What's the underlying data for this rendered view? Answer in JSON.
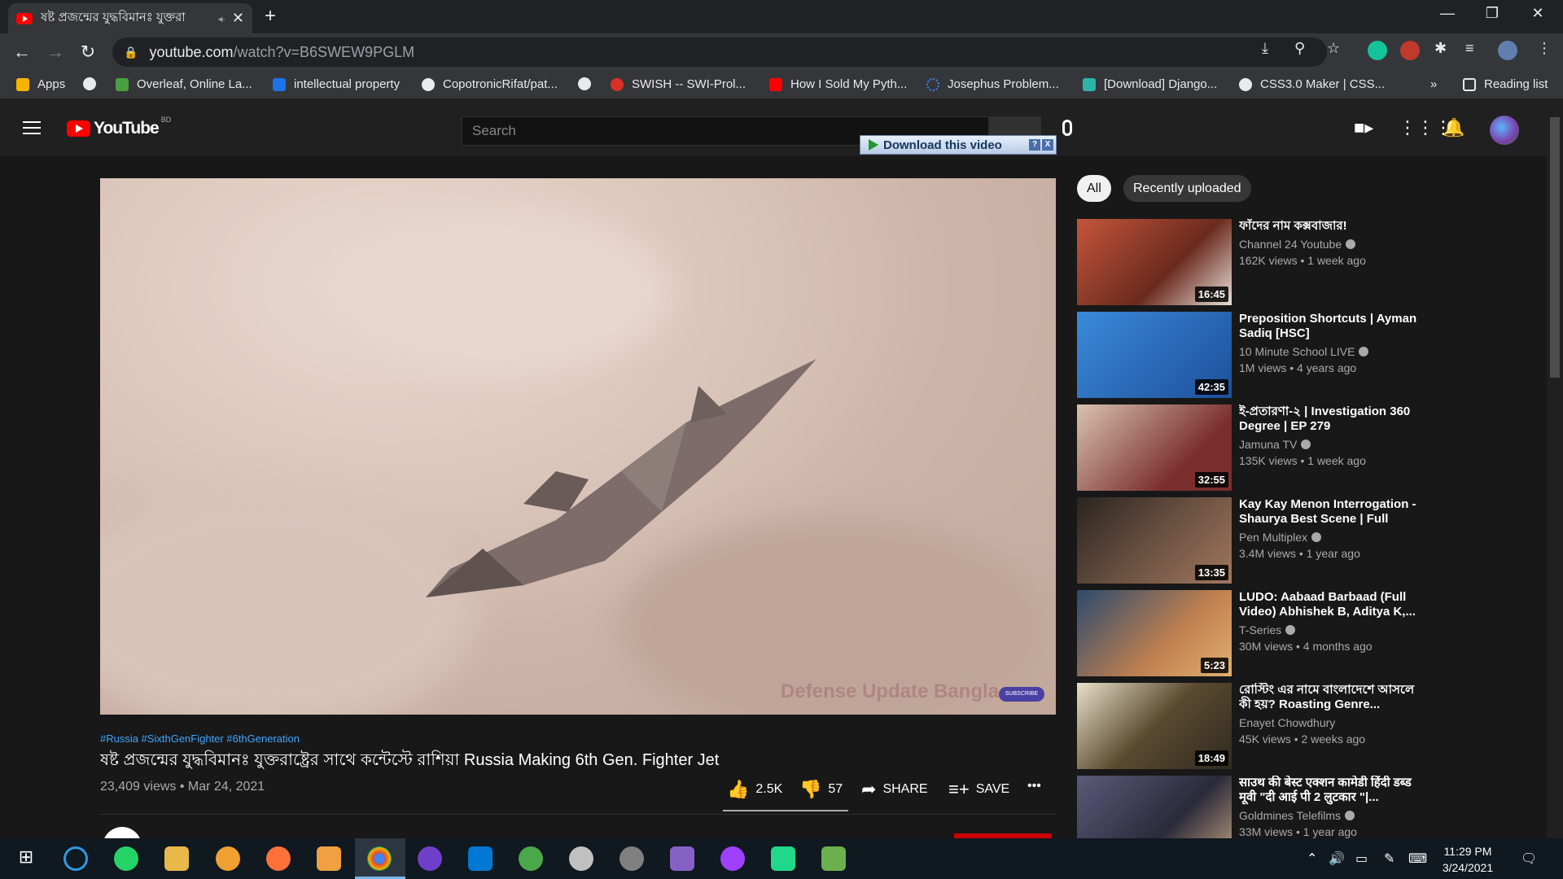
{
  "browser": {
    "tab_title": "ষষ্ট প্রজন্মের যুদ্ধবিমানঃ যুক্তরা",
    "tab_audio": "◂∙",
    "tab_close": "✕",
    "new_tab": "+",
    "win_min": "—",
    "win_max": "❐",
    "win_close": "✕",
    "url_host": "youtube.com",
    "url_path": "/watch?v=B6SWEW9PGLM",
    "nav_back": "←",
    "nav_forward": "→",
    "nav_reload": "↻",
    "lock": "🔒"
  },
  "bookmarks": {
    "items": [
      {
        "label": "Apps",
        "color": "#f4b400"
      },
      {
        "label": "",
        "color": "#e8eaed"
      },
      {
        "label": "Overleaf, Online La...",
        "color": "#47a141"
      },
      {
        "label": "intellectual property",
        "color": "#1a73e8"
      },
      {
        "label": "CopotronicRifat/pat...",
        "color": "#e8eaed"
      },
      {
        "label": "",
        "color": "#e8eaed"
      },
      {
        "label": "SWISH -- SWI-Prol...",
        "color": "#d93025"
      },
      {
        "label": "How I Sold My Pyth...",
        "color": "#ff0000"
      },
      {
        "label": "Josephus Problem...",
        "color": "#4285f4"
      },
      {
        "label": "[Download] Django...",
        "color": "#2bb5a8"
      },
      {
        "label": "CSS3.0 Maker | CSS...",
        "color": "#e8eaed"
      }
    ],
    "more": "»",
    "reading_list": "Reading list"
  },
  "youtube": {
    "logo_word": "YouTube",
    "country": "BD",
    "search_placeholder": "Search",
    "download_label": "Download this video",
    "download_help": "?",
    "download_close": "X"
  },
  "video": {
    "watermark": "Defense Update Bangla",
    "subscribe_badge": "SUBSCRIBE",
    "hashtags": "#Russia #SixthGenFighter #6thGeneration",
    "title": "ষষ্ট প্রজন্মের যুদ্ধবিমানঃ যুক্তরাষ্ট্রের সাথে কন্টেস্টে রাশিয়া Russia Making 6th Gen. Fighter Jet",
    "views_date": "23,409 views • Mar 24, 2021",
    "likes": "2.5K",
    "dislikes": "57",
    "share": "SHARE",
    "save": "SAVE",
    "more": "•••"
  },
  "chips": [
    "All",
    "Recently uploaded"
  ],
  "recommendations": [
    {
      "title": "ফাঁদের নাম কক্সবাজার!",
      "channel": "Channel 24 Youtube",
      "verified": true,
      "meta": "162K views • 1 week ago",
      "duration": "16:45",
      "thumb_color": "#8b3a2a"
    },
    {
      "title": "Preposition Shortcuts | Ayman Sadiq [HSC]",
      "channel": "10 Minute School LIVE",
      "verified": true,
      "meta": "1M views • 4 years ago",
      "duration": "42:35",
      "thumb_color": "#2a6fc9"
    },
    {
      "title": "ই-প্রতারণা-২ | Investigation 360 Degree | EP 279",
      "channel": "Jamuna TV",
      "verified": true,
      "meta": "135K views • 1 week ago",
      "duration": "32:55",
      "thumb_color": "#6b2a2a"
    },
    {
      "title": "Kay Kay Menon Interrogation - Shaurya Best Scene | Full Hind...",
      "channel": "Pen Multiplex",
      "verified": true,
      "meta": "3.4M views • 1 year ago",
      "duration": "13:35",
      "thumb_color": "#4a3a30"
    },
    {
      "title": "LUDO: Aabaad Barbaad (Full Video) Abhishek B, Aditya K,...",
      "channel": "T-Series",
      "verified": true,
      "meta": "30M views • 4 months ago",
      "duration": "5:23",
      "thumb_color": "#3a5a7a"
    },
    {
      "title": "রোস্টিং এর নামে বাংলাদেশে আসলে কী হয়? Roasting Genre...",
      "channel": "Enayet Chowdhury",
      "verified": false,
      "meta": "45K views • 2 weeks ago",
      "duration": "18:49",
      "thumb_color": "#5a4a30"
    },
    {
      "title": "साउथ की बेस्ट एक्शन कामेडी हिंदी डब्ड मूवी \"दी आई पी 2 लुटकार \"|...",
      "channel": "Goldmines Telefilms",
      "verified": true,
      "meta": "33M views • 1 year ago",
      "duration": "",
      "thumb_color": "#4a4a5a"
    }
  ],
  "taskbar": {
    "time": "11:29 PM",
    "date": "3/24/2021"
  }
}
